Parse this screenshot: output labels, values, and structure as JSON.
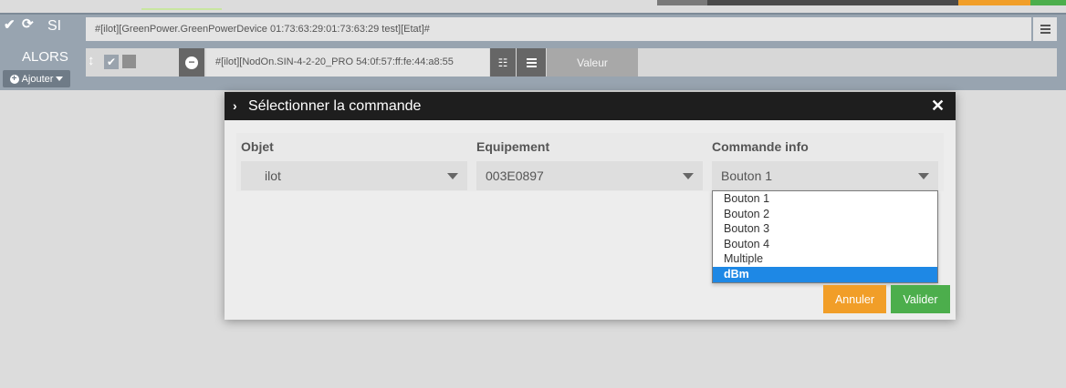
{
  "scenario": {
    "si_label": "SI",
    "alors_label": "ALORS",
    "si_expression": "#[ilot][GreenPower.GreenPowerDevice 01:73:63:29:01:73:63:29 test][Etat]#",
    "ajouter_label": "Ajouter",
    "action_command": "#[ilot][NodOn.SIN-4-2-20_PRO 54:0f:57:ff:fe:44:a8:55",
    "valeur_label": "Valeur"
  },
  "modal": {
    "title": "Sélectionner la commande",
    "columns": [
      {
        "label": "Objet",
        "value": "ilot"
      },
      {
        "label": "Equipement",
        "value": "003E0897"
      },
      {
        "label": "Commande info",
        "value": "Bouton 1"
      }
    ],
    "dropdown_options": [
      "Bouton 1",
      "Bouton 2",
      "Bouton 3",
      "Bouton 4",
      "Multiple",
      "dBm"
    ],
    "selected_option": "dBm",
    "cancel_label": "Annuler",
    "validate_label": "Valider"
  },
  "colors": {
    "cancel": "#f19e28",
    "validate": "#4cae4c",
    "selected_option": "#1e88e5",
    "modal_header": "#1e1e1e"
  }
}
